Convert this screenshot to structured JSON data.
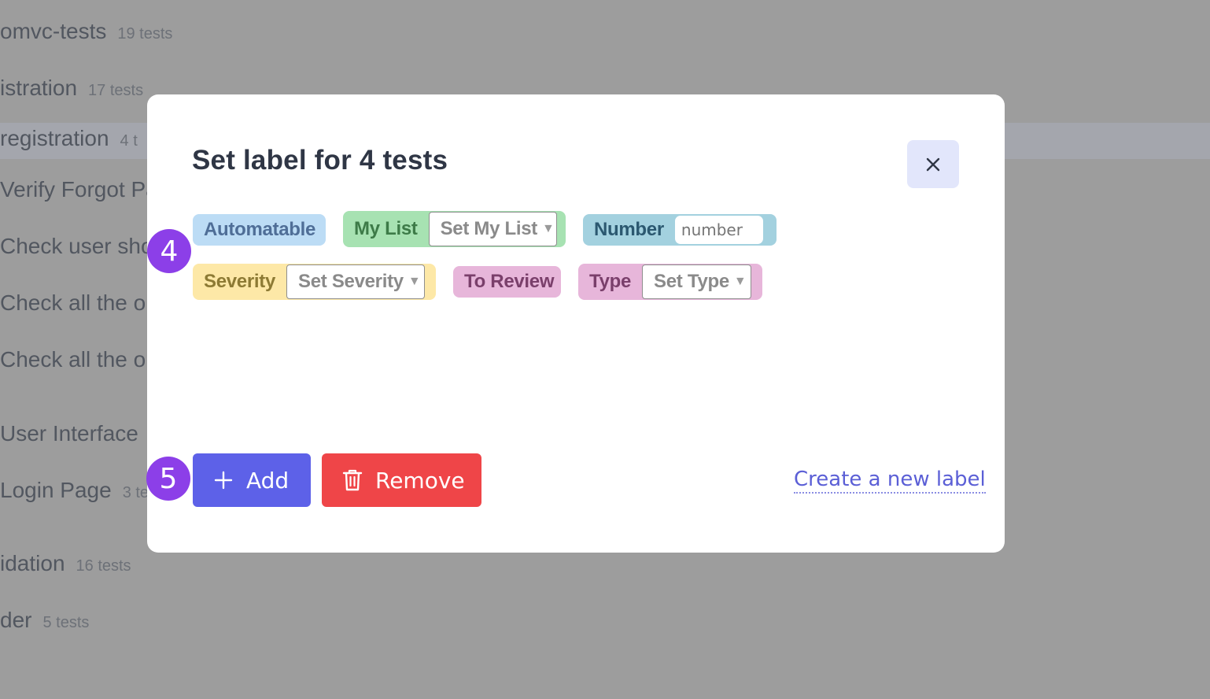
{
  "background_list": [
    {
      "text": "omvc-tests",
      "count": "19 tests"
    },
    {
      "text": "istration",
      "count": "17 tests"
    },
    {
      "text": "registration",
      "count": "4 t"
    },
    {
      "text": "Verify Forgot Pa",
      "count": ""
    },
    {
      "text": "Check user sho",
      "count": ""
    },
    {
      "text": "Check all the o",
      "count": ""
    },
    {
      "text": "Check all the o",
      "count": ""
    },
    {
      "text": "User Interface",
      "count": ""
    },
    {
      "text": "Login Page",
      "count": "3 te"
    },
    {
      "text": "idation",
      "count": "16 tests"
    },
    {
      "text": "der",
      "count": "5 tests"
    }
  ],
  "modal": {
    "title": "Set label for 4 tests",
    "close_icon": "close-icon",
    "labels": {
      "automatable": {
        "name": "Automatable",
        "color": "#bcdcf5",
        "text_color": "#4f6e97"
      },
      "my_list": {
        "name": "My List",
        "select": "Set My List",
        "color": "#a7e2b2",
        "text_color": "#3d7b48"
      },
      "number": {
        "name": "Number",
        "placeholder": "number",
        "color": "#a3d1df",
        "text_color": "#2b5870"
      },
      "severity": {
        "name": "Severity",
        "select": "Set Severity",
        "color": "#fde8a7",
        "text_color": "#8d7a34"
      },
      "to_review": {
        "name": "To Review",
        "color": "#e7b6da",
        "text_color": "#7a3f6b"
      },
      "type": {
        "name": "Type",
        "select": "Set Type",
        "color": "#e7b6da",
        "text_color": "#7a3f6b"
      }
    },
    "add_label": "Add",
    "remove_label": "Remove",
    "create_link": "Create a new label"
  },
  "annotations": {
    "step_4": "4",
    "step_5": "5"
  },
  "colors": {
    "badge": "#8c3fe8",
    "add": "#5d61e8",
    "remove": "#ef4548",
    "link": "#5b5fd6"
  }
}
